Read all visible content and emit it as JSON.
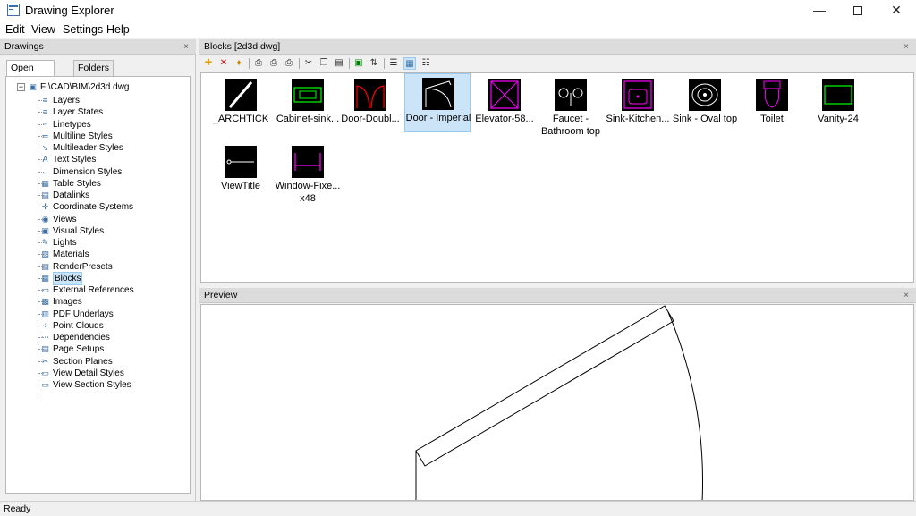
{
  "window": {
    "title": "Drawing Explorer",
    "minimize": "—",
    "close": "✕"
  },
  "menu": [
    "Edit",
    "View",
    "Settings",
    "Help"
  ],
  "drawings_panel": {
    "title": "Drawings",
    "close": "×",
    "tabs": [
      "Open Drawings",
      "Folders"
    ],
    "expander": "−",
    "root": "F:\\CAD\\BIM\\2d3d.dwg",
    "items": [
      "Layers",
      "Layer States",
      "Linetypes",
      "Multiline Styles",
      "Multileader Styles",
      "Text Styles",
      "Dimension Styles",
      "Table Styles",
      "Datalinks",
      "Coordinate Systems",
      "Views",
      "Visual Styles",
      "Lights",
      "Materials",
      "RenderPresets",
      "Blocks",
      "External References",
      "Images",
      "PDF Underlays",
      "Point Clouds",
      "Dependencies",
      "Page Setups",
      "Section Planes",
      "View Detail Styles",
      "View Section Styles"
    ],
    "selected_item": "Blocks"
  },
  "blocks_panel": {
    "title": "Blocks [2d3d.dwg]",
    "close": "×",
    "blocks": [
      {
        "label": "_ARCHTICK",
        "icon": "archtick-thumb"
      },
      {
        "label": "Cabinet-sink...",
        "icon": "cabinet-thumb"
      },
      {
        "label": "Door-Doubl...",
        "icon": "door-double-thumb"
      },
      {
        "label": "Door - Imperial",
        "icon": "door-imperial-thumb",
        "selected": true
      },
      {
        "label": "Elevator-58...",
        "icon": "elevator-thumb"
      },
      {
        "label": "Faucet - Bathroom top",
        "icon": "faucet-thumb"
      },
      {
        "label": "Sink-Kitchen...",
        "icon": "sink-kitchen-thumb"
      },
      {
        "label": "Sink - Oval top",
        "icon": "sink-oval-thumb"
      },
      {
        "label": "Toilet",
        "icon": "toilet-thumb"
      },
      {
        "label": "Vanity-24",
        "icon": "vanity-thumb"
      },
      {
        "label": "ViewTitle",
        "icon": "viewtitle-thumb"
      },
      {
        "label": "Window-Fixe... x48",
        "icon": "window-thumb"
      }
    ]
  },
  "preview_panel": {
    "title": "Preview",
    "close": "×"
  },
  "status": {
    "text": "Ready"
  },
  "colors": {
    "accent_selection": "#cce4f7",
    "thumb_bg": "#000000",
    "green": "#00ff00",
    "red": "#ff0000",
    "magenta": "#ff00ff"
  }
}
